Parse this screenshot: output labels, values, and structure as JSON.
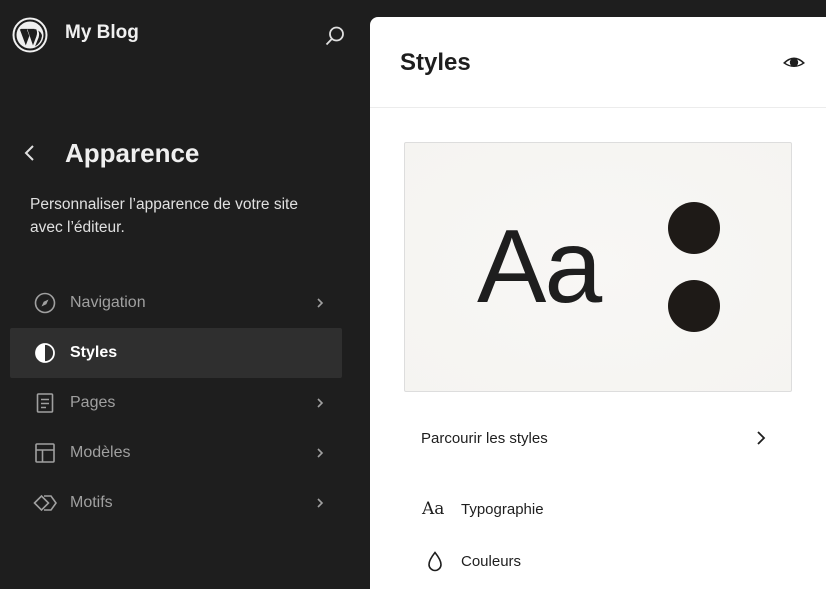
{
  "site": {
    "title": "My Blog"
  },
  "panel": {
    "title": "Apparence",
    "description": "Personnaliser l’apparence de votre site avec l’éditeur."
  },
  "nav": {
    "items": [
      {
        "label": "Navigation",
        "icon": "compass-icon",
        "active": false
      },
      {
        "label": "Styles",
        "icon": "half-circle-icon",
        "active": true
      },
      {
        "label": "Pages",
        "icon": "page-icon",
        "active": false
      },
      {
        "label": "Modèles",
        "icon": "layout-icon",
        "active": false
      },
      {
        "label": "Motifs",
        "icon": "diamond-icon",
        "active": false
      }
    ]
  },
  "main": {
    "title": "Styles",
    "preview": {
      "sample_text": "Aa"
    },
    "browse_label": "Parcourir les styles",
    "items": [
      {
        "label": "Typographie",
        "icon": "typography-icon",
        "glyph": "Aa"
      },
      {
        "label": "Couleurs",
        "icon": "droplet-icon"
      }
    ]
  },
  "colors": {
    "sidebar_bg": "#1e1e1e",
    "active_item_bg": "#2f2f2f",
    "main_bg": "#ffffff",
    "swatch": "#1e1a17"
  }
}
